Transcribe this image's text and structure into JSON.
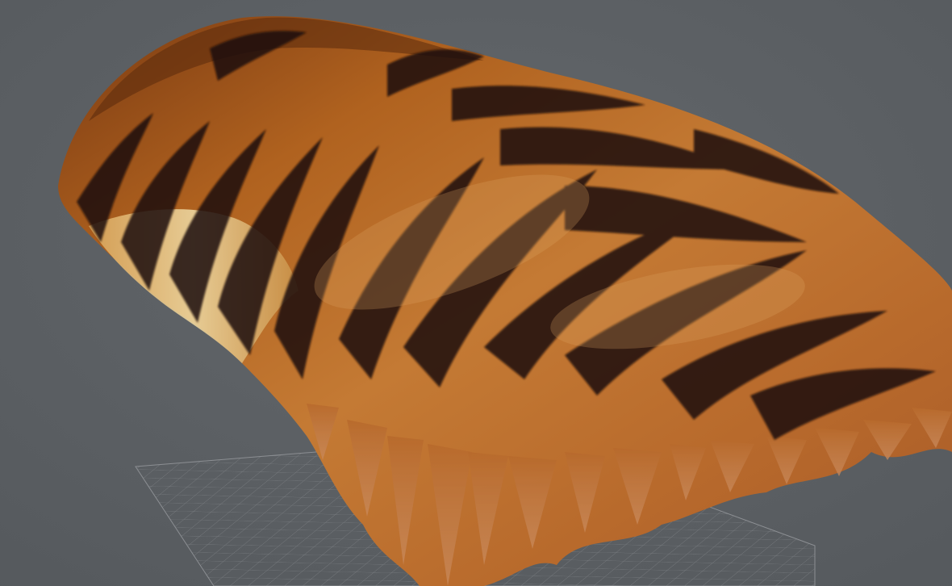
{
  "viewport": {
    "background_color": "#5c6064",
    "grid_color": "#8c8f93",
    "fur_colors": {
      "base_orange": "#b86a26",
      "deep_orange": "#8a4215",
      "light_cream": "#e2c88c",
      "highlight": "#d99a55",
      "stripe_black": "#1a1008"
    },
    "grid_visible": true,
    "object_type": "fur-groom-preview"
  }
}
